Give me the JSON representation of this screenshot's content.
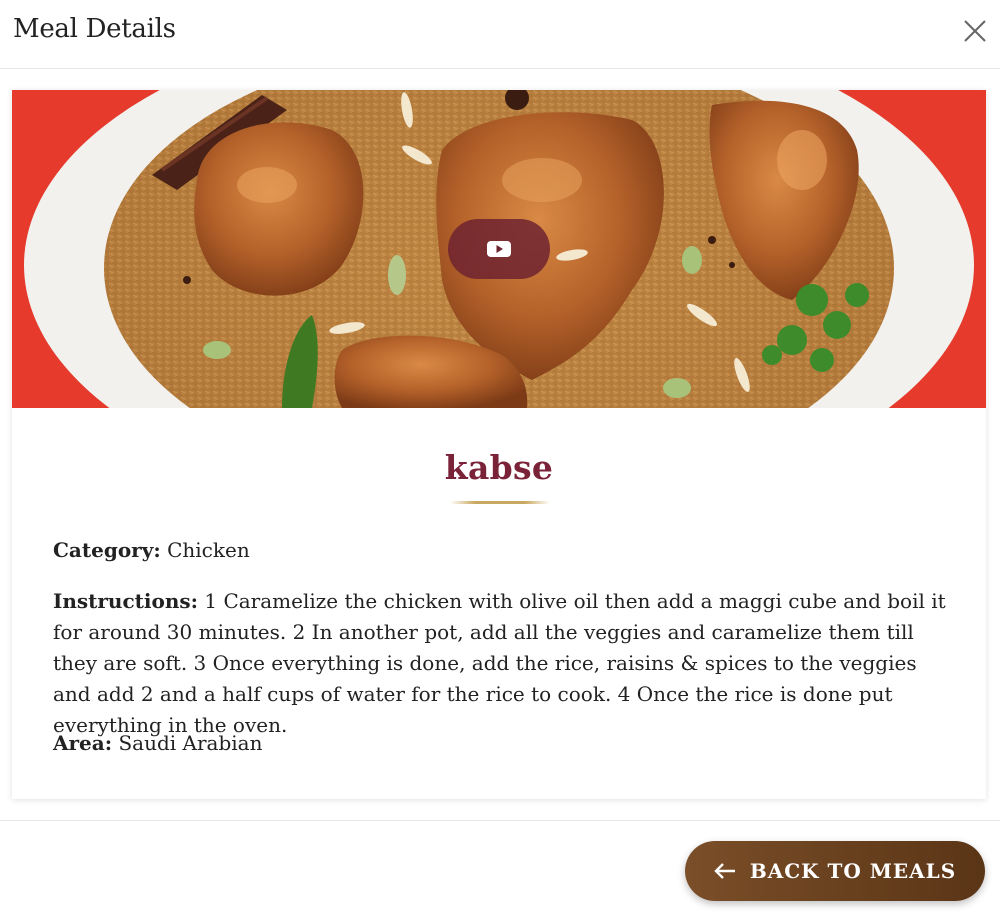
{
  "modal": {
    "title": "Meal Details",
    "close_icon": "close-icon"
  },
  "meal": {
    "name": "kabse",
    "image_play_icon": "youtube-play-icon",
    "category_label": "Category:",
    "category_value": "Chicken",
    "instructions_label": "Instructions:",
    "instructions_value": "1 Caramelize the chicken with olive oil then add a maggi cube and boil it for around 30 minutes. 2 In another pot, add all the veggies and caramelize them till they are soft. 3 Once everything is done, add the rice, raisins & spices to the veggies and add 2 and a half cups of water for the rice to cook. 4 Once the rice is done put everything in the oven.",
    "area_label": "Area:",
    "area_value": "Saudi Arabian"
  },
  "footer": {
    "back_label": "BACK TO MEALS",
    "back_icon": "arrow-left-icon"
  },
  "colors": {
    "title_color": "#7a2237",
    "underline_gold": "#c9a961",
    "button_brown": "#6b4220",
    "play_button": "#6e2330"
  }
}
